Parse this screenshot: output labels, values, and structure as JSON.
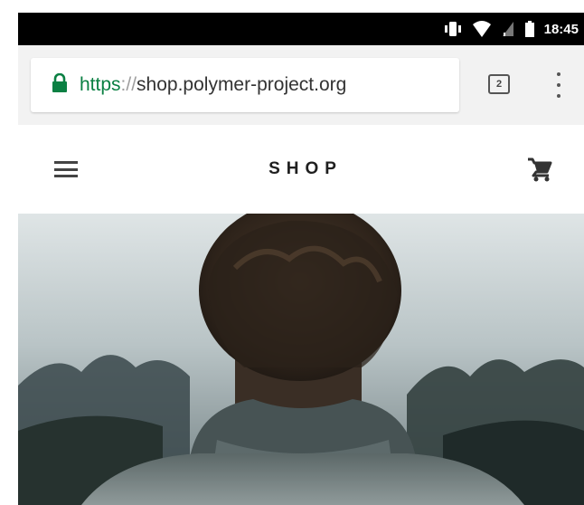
{
  "status_bar": {
    "time": "18:45",
    "icons": [
      "vibrate-icon",
      "wifi-icon",
      "signal-icon",
      "battery-icon"
    ]
  },
  "browser": {
    "url_scheme": "https",
    "url_separator": "://",
    "url_host": "shop.polymer-project.org",
    "tab_count": "2",
    "icons": [
      "lock-icon",
      "tabs-icon",
      "overflow-menu-icon"
    ]
  },
  "app_header": {
    "title": "SHOP",
    "icons": [
      "hamburger-menu-icon",
      "shopping-cart-icon"
    ]
  },
  "hero": {
    "image": "person-back-view-foggy-forest"
  },
  "colors": {
    "status_bar_bg": "#000000",
    "toolbar_bg": "#f2f2f2",
    "secure_green": "#0b8043",
    "title_text": "#202020"
  }
}
